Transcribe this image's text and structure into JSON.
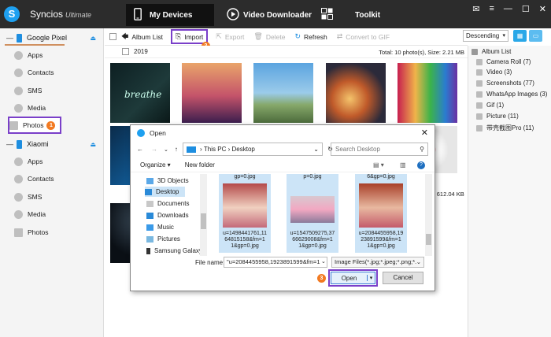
{
  "app": {
    "logo": "S",
    "name": "Syncios",
    "edition": "Ultimate"
  },
  "nav": {
    "tabs": [
      {
        "label": "My Devices",
        "icon": "phone-icon"
      },
      {
        "label": "Video Downloader",
        "icon": "play-icon"
      },
      {
        "label": "Toolkit",
        "icon": "grid-icon"
      }
    ]
  },
  "window_controls": [
    "✉",
    "≡",
    "—",
    "☐",
    "✕"
  ],
  "sidebar": {
    "devices": [
      {
        "name": "Google Pixel",
        "items": [
          "Apps",
          "Contacts",
          "SMS",
          "Media",
          "Photos"
        ]
      },
      {
        "name": "Xiaomi",
        "items": [
          "Apps",
          "Contacts",
          "SMS",
          "Media",
          "Photos"
        ]
      }
    ],
    "photos_badge": "1"
  },
  "toolbar": {
    "album_list": "Album List",
    "import": "Import",
    "export": "Export",
    "delete": "Delete",
    "refresh": "Refresh",
    "convert": "Convert to GIF",
    "import_badge": "2",
    "sort": "Descending"
  },
  "content": {
    "year": "2019",
    "total": "Total: 10 photo(s), Size: 2.21 MB",
    "size2": "ize: 612.04 KB"
  },
  "album_panel": {
    "title": "Album List",
    "items": [
      "Camera Roll (7)",
      "Video (3)",
      "Screenshots (77)",
      "WhatsApp Images (3)",
      "Gif (1)",
      "Picture (11)",
      "带壳截图Pro (11)"
    ]
  },
  "dialog": {
    "title": "Open",
    "path": [
      "This PC",
      "Desktop"
    ],
    "search_placeholder": "Search Desktop",
    "organize": "Organize ▾",
    "new_folder": "New folder",
    "nav_items": [
      "3D Objects",
      "Desktop",
      "Documents",
      "Downloads",
      "Music",
      "Pictures",
      "Samsung Galaxy"
    ],
    "file_tops": [
      "gp=0.jpg",
      "p=0.jpg",
      "6&gp=0.jpg"
    ],
    "files": [
      {
        "name": "u=1498441761,11 64815158&fm=1 1&gp=0.jpg"
      },
      {
        "name": "u=1547509275,37 66629008&fm=1 1&gp=0.jpg"
      },
      {
        "name": "u=2084455958,19 23891599&fm=1 1&gp=0.jpg"
      }
    ],
    "filename_label": "File name:",
    "filename_value": "\"u=2084455958,1923891599&fm=1",
    "filetype": "Image Files(*.jpg;*.jpeg;*.png;*.",
    "open": "Open",
    "cancel": "Cancel",
    "open_badge": "3"
  }
}
